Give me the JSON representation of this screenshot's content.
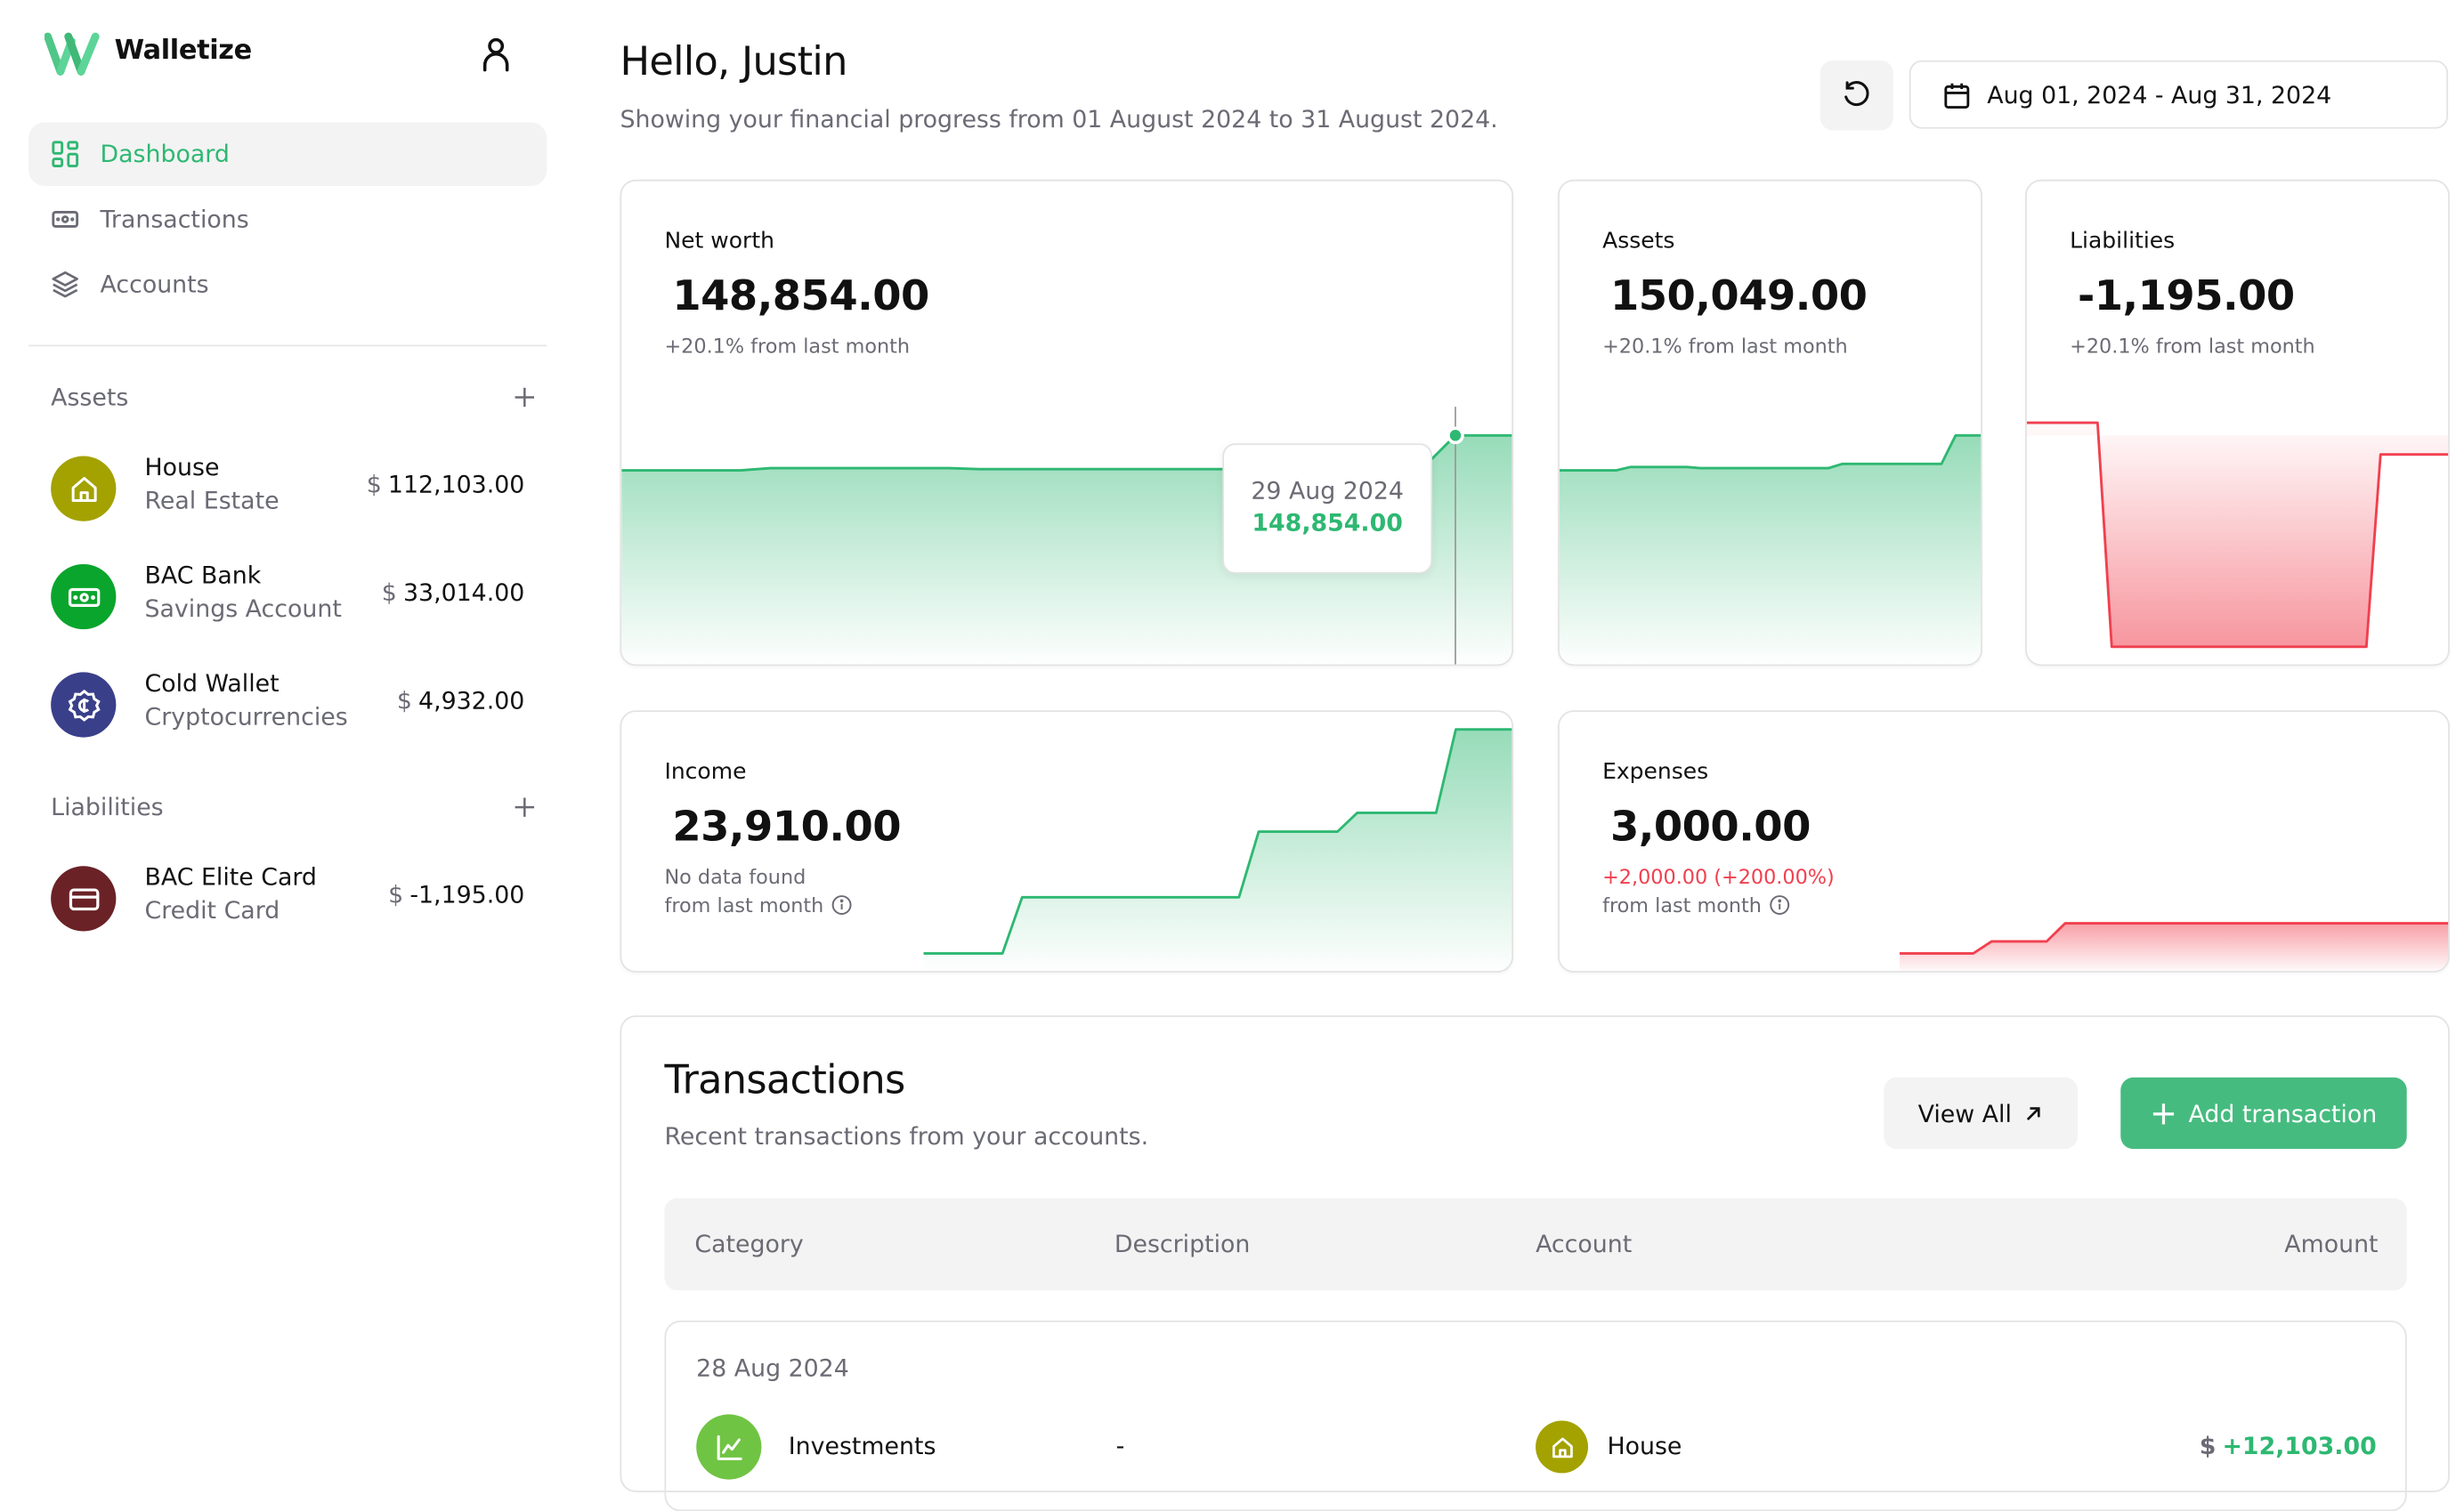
{
  "app": {
    "name": "Walletize"
  },
  "colors": {
    "accent": "#2eb872",
    "accent_button": "#46bb7f",
    "negative": "#f0404f",
    "muted_text": "#6b6b75",
    "house_icon_bg": "#a3a200",
    "bank_icon_bg": "#0aa52c",
    "crypto_icon_bg": "#3a3f8a",
    "credit_card_icon_bg": "#6a2226",
    "investments_icon_bg": "#70c443"
  },
  "sidebar": {
    "nav": [
      {
        "label": "Dashboard",
        "icon": "dashboard-grid-icon",
        "active": true
      },
      {
        "label": "Transactions",
        "icon": "banknote-icon",
        "active": false
      },
      {
        "label": "Accounts",
        "icon": "layers-icon",
        "active": false
      }
    ],
    "assets": {
      "title": "Assets",
      "items": [
        {
          "name": "House",
          "type": "Real Estate",
          "currency": "$",
          "amount": "112,103.00",
          "icon": "house-icon"
        },
        {
          "name": "BAC Bank",
          "type": "Savings Account",
          "currency": "$",
          "amount": "33,014.00",
          "icon": "banknote-icon"
        },
        {
          "name": "Cold Wallet",
          "type": "Cryptocurrencies",
          "currency": "$",
          "amount": "4,932.00",
          "icon": "crypto-coin-icon"
        }
      ]
    },
    "liabilities": {
      "title": "Liabilities",
      "items": [
        {
          "name": "BAC Elite Card",
          "type": "Credit Card",
          "currency": "$",
          "amount": "-1,195.00",
          "icon": "credit-card-icon"
        }
      ]
    }
  },
  "header": {
    "greeting": "Hello, Justin",
    "subtitle": "Showing your financial progress from 01 August 2024 to 31 August 2024.",
    "date_range": "Aug 01, 2024 - Aug 31, 2024"
  },
  "cards": {
    "net_worth": {
      "title": "Net worth",
      "value": "148,854.00",
      "delta": "+20.1% from last month"
    },
    "assets": {
      "title": "Assets",
      "value": "150,049.00",
      "delta": "+20.1% from last month"
    },
    "liabilities": {
      "title": "Liabilities",
      "value": "-1,195.00",
      "delta": "+20.1% from last month"
    },
    "income": {
      "title": "Income",
      "value": "23,910.00",
      "delta_line1": "No data found",
      "delta_line2": "from last month"
    },
    "expenses": {
      "title": "Expenses",
      "value": "3,000.00",
      "delta_line1": "+2,000.00 (+200.00%)",
      "delta_line2": "from last month"
    }
  },
  "tooltip": {
    "date": "29 Aug 2024",
    "value": "148,854.00"
  },
  "chart_data": [
    {
      "type": "area",
      "title": "Net worth",
      "x": [
        "Aug 01",
        "Aug 05",
        "Aug 06",
        "Aug 12",
        "Aug 13",
        "Aug 22",
        "Aug 23",
        "Aug 28",
        "Aug 29",
        "Aug 31"
      ],
      "values": [
        133000,
        133000,
        134000,
        134000,
        133600,
        133600,
        135400,
        135400,
        148854,
        148854
      ],
      "highlight": {
        "x": "29 Aug 2024",
        "value": 148854
      }
    },
    {
      "type": "area",
      "title": "Assets",
      "x": [
        "Aug 01",
        "Aug 05",
        "Aug 06",
        "Aug 10",
        "Aug 11",
        "Aug 20",
        "Aug 21",
        "Aug 28",
        "Aug 29",
        "Aug 31"
      ],
      "values": [
        134000,
        134000,
        135500,
        135500,
        135000,
        135000,
        137000,
        137000,
        150049,
        150049
      ]
    },
    {
      "type": "area",
      "title": "Liabilities",
      "x": [
        "Aug 01",
        "Aug 06",
        "Aug 07",
        "Aug 25",
        "Aug 26",
        "Aug 31"
      ],
      "values": [
        -600,
        -600,
        -4800,
        -4800,
        -1195,
        -1195
      ]
    },
    {
      "type": "area",
      "title": "Income",
      "x": [
        "Aug 01",
        "Aug 05",
        "Aug 06",
        "Aug 17",
        "Aug 18",
        "Aug 22",
        "Aug 23",
        "Aug 27",
        "Aug 28",
        "Aug 31"
      ],
      "values": [
        0,
        0,
        6000,
        6000,
        13000,
        13000,
        15000,
        15000,
        23910,
        23910
      ]
    },
    {
      "type": "area",
      "title": "Expenses",
      "x": [
        "Aug 01",
        "Aug 05",
        "Aug 06",
        "Aug 09",
        "Aug 10",
        "Aug 31"
      ],
      "values": [
        0,
        0,
        1200,
        1200,
        3000,
        3000
      ]
    }
  ],
  "transactions": {
    "title": "Transactions",
    "subtitle": "Recent transactions from your accounts.",
    "view_all": "View All",
    "add": "Add transaction",
    "columns": [
      "Category",
      "Description",
      "Account",
      "Amount"
    ],
    "groups": [
      {
        "date": "28 Aug 2024",
        "rows": [
          {
            "category": "Investments",
            "description": "-",
            "account": "House",
            "currency": "$",
            "amount": "+12,103.00"
          }
        ]
      }
    ]
  }
}
